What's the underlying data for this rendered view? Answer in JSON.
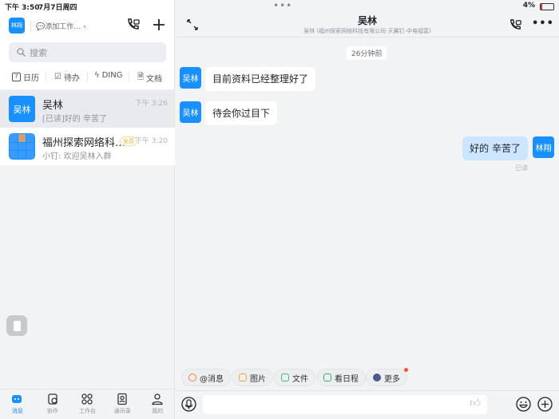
{
  "status_bar": {
    "time": "下午 3:50",
    "date": "7月7日周四",
    "battery": "4%"
  },
  "left": {
    "user_avatar": "林翔",
    "add_work": "添加工作…",
    "search_placeholder": "搜索",
    "shortcuts": [
      {
        "label": "日历",
        "icon": "calendar-icon"
      },
      {
        "label": "待办",
        "icon": "todo-icon"
      },
      {
        "label": "DING",
        "icon": "ding-icon"
      },
      {
        "label": "文档",
        "icon": "doc-icon"
      }
    ],
    "conversations": [
      {
        "avatar": "吴林",
        "name": "吴林",
        "preview": "[已读]好的  辛苦了",
        "time": "下午 3:26",
        "selected": true
      },
      {
        "name": "福州探索网络科…",
        "badge": "全员",
        "preview": "小钉: 欢迎吴林入群",
        "time": "下午 3:20"
      }
    ],
    "tabs": [
      {
        "label": "消息",
        "active": true
      },
      {
        "label": "协作"
      },
      {
        "label": "工作台"
      },
      {
        "label": "通讯录"
      },
      {
        "label": "我的"
      }
    ]
  },
  "chat": {
    "title": "吴林",
    "subtitle": "吴林 (福州探索网络科技有限公司-天翼钉-中电福富)",
    "time_divider": "26分钟前",
    "messages": [
      {
        "from": "吴林",
        "avatar": "吴林",
        "text": "目前资料已经整理好了"
      },
      {
        "from": "吴林",
        "avatar": "吴林",
        "text": "待会你过目下"
      },
      {
        "from": "me",
        "avatar": "林翔",
        "text": "好的  辛苦了",
        "status": "已读"
      }
    ],
    "quick_actions": [
      {
        "label": "@消息",
        "color": "#f5883d"
      },
      {
        "label": "图片",
        "color": "#f5a623"
      },
      {
        "label": "文件",
        "color": "#3bbf6b"
      },
      {
        "label": "看日程",
        "color": "#2eb860"
      },
      {
        "label": "更多",
        "color": "#4a5a8c"
      }
    ],
    "accent": "#1890ff"
  }
}
